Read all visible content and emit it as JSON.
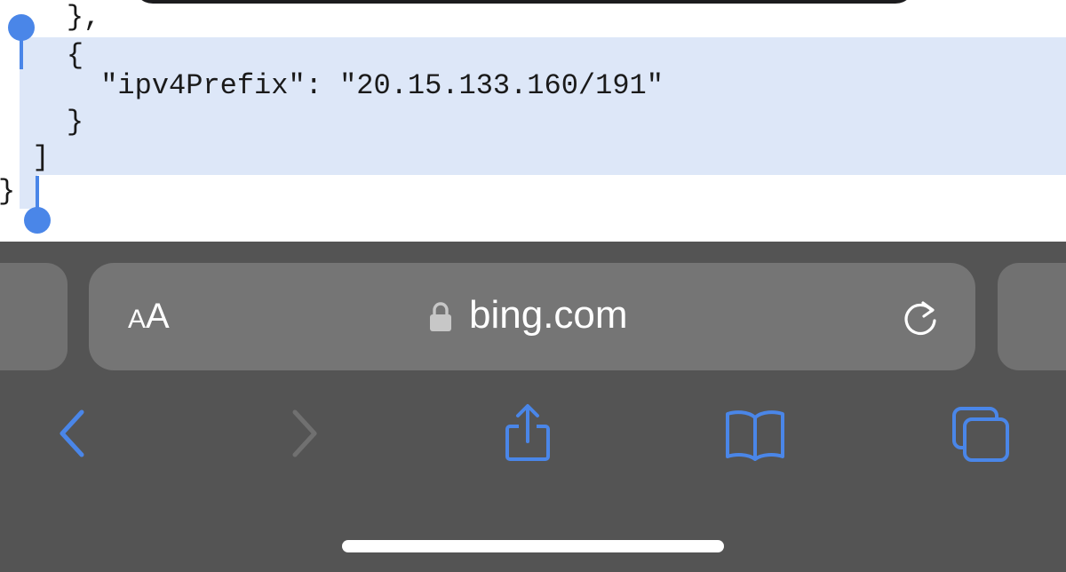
{
  "code": {
    "lines": [
      "    },",
      "    {",
      "      \"ipv4Prefix\": \"20.15.133.160/191\"",
      "    }",
      "  ]",
      "}"
    ]
  },
  "address_bar": {
    "text_size_small": "A",
    "text_size_large": "A",
    "url": "bing.com"
  },
  "icons": {
    "lock": "lock-icon",
    "reload": "reload-icon",
    "back": "chevron-left-icon",
    "forward": "chevron-right-icon",
    "share": "share-icon",
    "bookmarks": "book-icon",
    "tabs": "tabs-icon"
  },
  "colors": {
    "selection": "#dde7f8",
    "accent": "#4a86e8",
    "toolbar": "#545454",
    "address_bar": "#757575"
  }
}
